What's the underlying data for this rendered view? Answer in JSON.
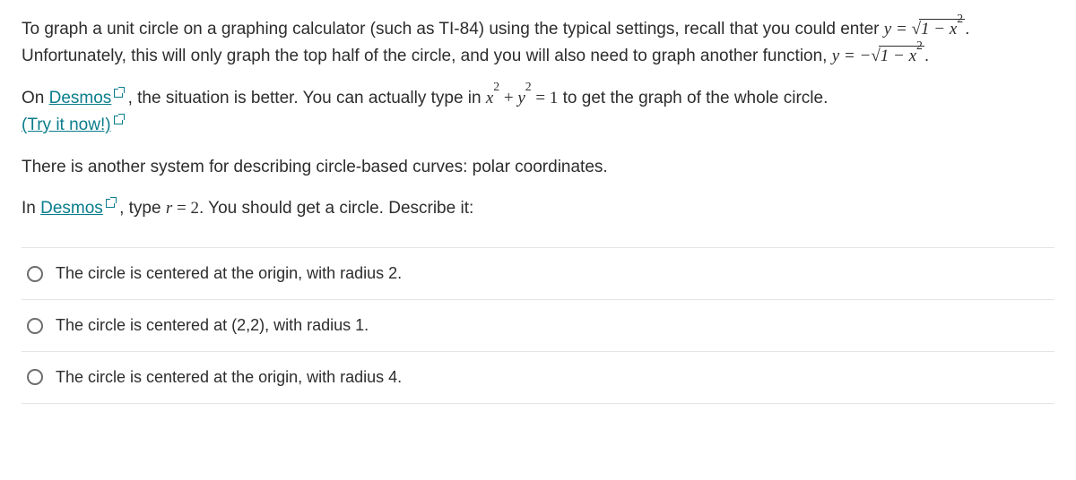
{
  "p1": {
    "t1": "To graph a unit circle on a graphing calculator (such as TI-84) using the typical settings, recall that you could enter ",
    "eq1_lhs": "y = ",
    "eq1_rad": "1 − x",
    "t2": ". Unfortunately, this will only graph the top half of the circle, and you will also need to graph another function, ",
    "eq2_lhs": "y = −",
    "eq2_rad": "1 − x",
    "t3": "."
  },
  "p2": {
    "t1": "On ",
    "link1": "Desmos",
    "t2": " , the situation is better. You can actually type in ",
    "eq_x": "x",
    "eq_plus": " + ",
    "eq_y": "y",
    "eq_rhs": " = 1",
    "t3": " to get the graph of the whole circle. ",
    "link2": "(Try it now!)"
  },
  "p3": "There is another system for describing circle-based curves: polar coordinates.",
  "p4": {
    "t1": "In ",
    "link1": "Desmos",
    "t2": " , type ",
    "eq_r": "r",
    "eq_rhs": " = 2",
    "t3": ". You should get a circle. Describe it:"
  },
  "options": [
    "The circle is centered at the origin, with radius 2.",
    "The circle is centered at (2,2), with radius 1.",
    "The circle is centered at the origin, with radius 4."
  ]
}
